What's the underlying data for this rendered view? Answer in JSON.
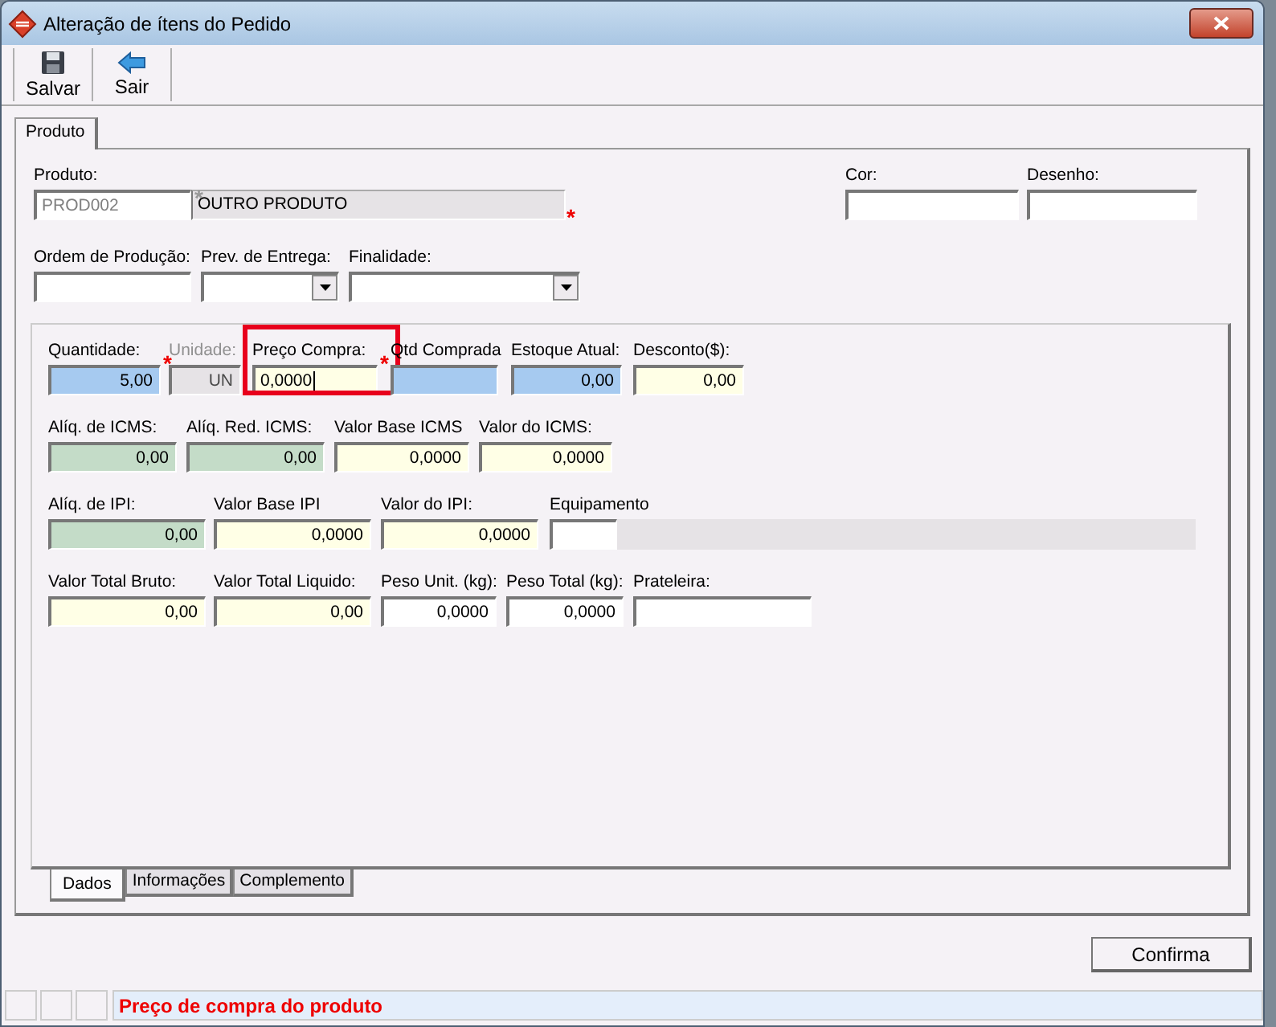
{
  "window": {
    "title": "Alteração de ítens do Pedido"
  },
  "toolbar": [
    {
      "label": "Salvar",
      "kind": "save"
    },
    {
      "label": "Sair",
      "kind": "exit"
    }
  ],
  "tabs": [
    {
      "label": "Produto",
      "selected": true
    }
  ],
  "product": {
    "label": "Produto:",
    "code": "PROD002",
    "code_mark": "*",
    "description": "OUTRO PRODUTO",
    "description_mark": "*"
  },
  "color_field": {
    "label": "Cor:"
  },
  "design_field": {
    "label": "Desenho:"
  },
  "order_fields": [
    {
      "label": "Ordem de Produção:",
      "kind": "text"
    },
    {
      "label": "Prev. de Entrega:",
      "kind": "dropdown"
    },
    {
      "label": "Finalidade:",
      "kind": "dropdown"
    }
  ],
  "field_rows": [
    [
      {
        "label": "Quantidade:",
        "value": "5,00",
        "color": "#a6caf0",
        "mark": "*",
        "disabled": false,
        "focused": false
      },
      {
        "label": "Unidade:",
        "value": "UN",
        "color": "#e6e3e6",
        "disabled": true,
        "focused": false
      },
      {
        "label": "Preço Compra:",
        "value": "0,0000",
        "color": "#ffffe6",
        "mark": "*",
        "disabled": false,
        "focused": true
      },
      {
        "label": "Qtd Comprada",
        "color": "#a6caf0",
        "disabled": false,
        "focused": false
      },
      {
        "label": "Estoque Atual:",
        "value": "0,00",
        "color": "#a6caf0",
        "disabled": false,
        "focused": false
      },
      {
        "label": "Desconto($):",
        "value": "0,00",
        "color": "#ffffe6",
        "disabled": false,
        "focused": false
      }
    ],
    [
      {
        "label": "Alíq. de ICMS:",
        "value": "0,00",
        "color": "#c4dcc8",
        "disabled": false,
        "focused": false
      },
      {
        "label": "Alíq. Red. ICMS:",
        "value": "0,00",
        "color": "#c4dcc8",
        "disabled": false,
        "focused": false
      },
      {
        "label": "Valor Base ICMS",
        "value": "0,0000",
        "color": "#ffffe6",
        "disabled": false,
        "focused": false
      },
      {
        "label": "Valor do ICMS:",
        "value": "0,0000",
        "color": "#ffffe6",
        "disabled": false,
        "focused": false
      }
    ],
    [
      {
        "label": "Alíq. de IPI:",
        "value": "0,00",
        "color": "#c4dcc8",
        "disabled": false,
        "focused": false
      },
      {
        "label": "Valor Base IPI",
        "value": "0,0000",
        "color": "#ffffe6",
        "disabled": false,
        "focused": false
      },
      {
        "label": "Valor do IPI:",
        "value": "0,0000",
        "color": "#ffffe6",
        "disabled": false,
        "focused": false
      },
      {
        "label": "Equipamento",
        "color": "#ffffff",
        "kind": "split",
        "disabled": false,
        "focused": false
      }
    ],
    [
      {
        "label": "Valor Total Bruto:",
        "value": "0,00",
        "color": "#ffffe6",
        "disabled": false,
        "focused": false
      },
      {
        "label": "Valor Total Liquido:",
        "value": "0,00",
        "color": "#ffffe6",
        "disabled": false,
        "focused": false
      },
      {
        "label": "Peso Unit. (kg):",
        "value": "0,0000",
        "color": "#ffffff",
        "disabled": false,
        "focused": false
      },
      {
        "label": "Peso Total (kg):",
        "value": "0,0000",
        "color": "#ffffff",
        "disabled": false,
        "focused": false
      },
      {
        "label": "Prateleira:",
        "color": "#ffffff",
        "disabled": false,
        "focused": false
      }
    ]
  ],
  "bottom_tabs": [
    {
      "label": "Dados",
      "selected": true
    },
    {
      "label": "Informações",
      "selected": false
    },
    {
      "label": "Complemento",
      "selected": false
    }
  ],
  "confirm_button": "Confirma",
  "status_bar": {
    "message": "Preço de compra do produto"
  }
}
